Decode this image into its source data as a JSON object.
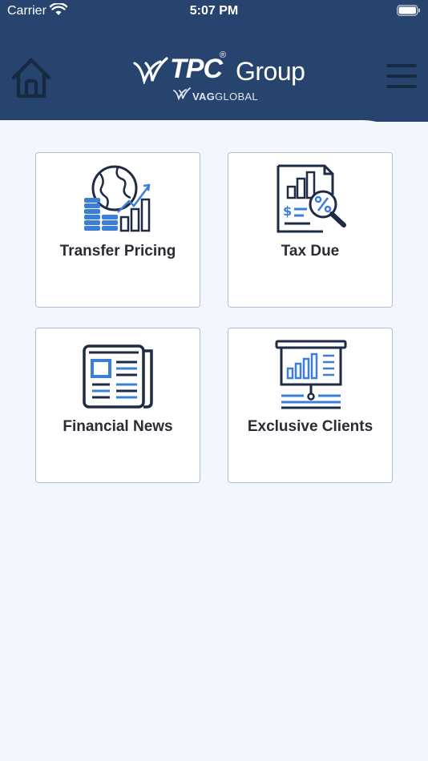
{
  "status_bar": {
    "carrier": "Carrier",
    "time": "5:07 PM"
  },
  "header": {
    "logo_tpc": "TPC",
    "logo_reg": "®",
    "logo_group": "Group",
    "logo_sub_bold": "VAG",
    "logo_sub_light": "GLOBAL"
  },
  "cards": [
    {
      "label": "Transfer Pricing",
      "icon": "globe-coins-chart-icon"
    },
    {
      "label": "Tax Due",
      "icon": "report-magnifier-percent-icon"
    },
    {
      "label": "Financial News",
      "icon": "newspaper-icon"
    },
    {
      "label": "Exclusive Clients",
      "icon": "presentation-board-icon"
    }
  ],
  "colors": {
    "header": "#27446e",
    "background": "#f3f7fd",
    "icon_dark": "#1f2a44",
    "icon_accent": "#3c7fd6",
    "card_border": "#a8c1e0"
  }
}
